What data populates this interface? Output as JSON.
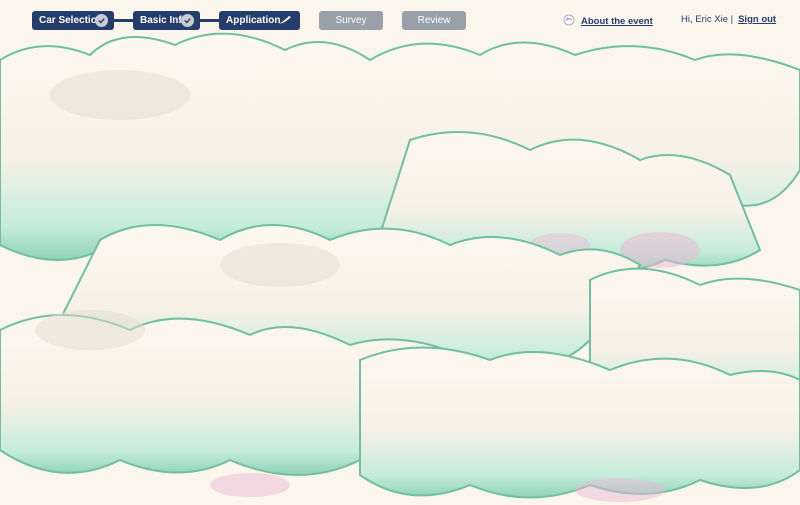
{
  "steps": [
    {
      "label": "Car Selection",
      "state": "done"
    },
    {
      "label": "Basic Info",
      "state": "done"
    },
    {
      "label": "Application",
      "state": "active"
    },
    {
      "label": "Survey",
      "state": "pending"
    },
    {
      "label": "Review",
      "state": "pending"
    }
  ],
  "header": {
    "about_link": "About the event",
    "greeting": "Hi, Eric Xie |",
    "sign_out": "Sign out"
  },
  "colors": {
    "navy": "#253d6b",
    "pending": "#9aa0aa",
    "background": "#fbf6ec",
    "cloud_mint": "#b9e6d4",
    "cloud_pink": "#e9b9d6"
  }
}
